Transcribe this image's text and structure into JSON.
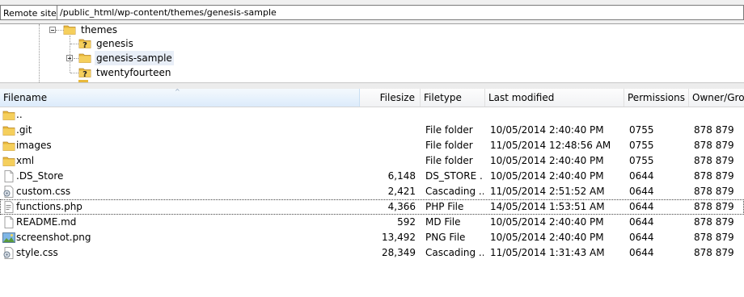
{
  "remote": {
    "label": "Remote site:",
    "path": "/public_html/wp-content/themes/genesis-sample"
  },
  "tree": {
    "items": [
      {
        "label": "themes",
        "icon": "folder-icon"
      },
      {
        "label": "genesis",
        "icon": "unknown-folder-icon"
      },
      {
        "label": "genesis-sample",
        "icon": "folder-icon"
      },
      {
        "label": "twentyfourteen",
        "icon": "unknown-folder-icon"
      }
    ]
  },
  "columns": {
    "filename": "Filename",
    "filesize": "Filesize",
    "filetype": "Filetype",
    "modified": "Last modified",
    "permissions": "Permissions",
    "owner": "Owner/Gro..."
  },
  "sort": {
    "column": "Filename",
    "indicator": "^"
  },
  "files": [
    {
      "name": "..",
      "size": "",
      "type": "",
      "modified": "",
      "perm": "",
      "owner": "",
      "icon": "folder-icon"
    },
    {
      "name": ".git",
      "size": "",
      "type": "File folder",
      "modified": "10/05/2014 2:40:40 PM",
      "perm": "0755",
      "owner": "878 879",
      "icon": "folder-icon"
    },
    {
      "name": "images",
      "size": "",
      "type": "File folder",
      "modified": "11/05/2014 12:48:56 AM",
      "perm": "0755",
      "owner": "878 879",
      "icon": "folder-icon"
    },
    {
      "name": "xml",
      "size": "",
      "type": "File folder",
      "modified": "10/05/2014 2:40:40 PM",
      "perm": "0755",
      "owner": "878 879",
      "icon": "folder-icon"
    },
    {
      "name": ".DS_Store",
      "size": "6,148",
      "type": "DS_STORE ...",
      "modified": "10/05/2014 2:40:40 PM",
      "perm": "0644",
      "owner": "878 879",
      "icon": "blank-file-icon"
    },
    {
      "name": "custom.css",
      "size": "2,421",
      "type": "Cascading ...",
      "modified": "11/05/2014 2:51:52 AM",
      "perm": "0644",
      "owner": "878 879",
      "icon": "css-file-icon"
    },
    {
      "name": "functions.php",
      "size": "4,366",
      "type": "PHP File",
      "modified": "14/05/2014 1:53:51 AM",
      "perm": "0644",
      "owner": "878 879",
      "icon": "php-file-icon"
    },
    {
      "name": "README.md",
      "size": "592",
      "type": "MD File",
      "modified": "10/05/2014 2:40:40 PM",
      "perm": "0644",
      "owner": "878 879",
      "icon": "blank-file-icon"
    },
    {
      "name": "screenshot.png",
      "size": "13,492",
      "type": "PNG File",
      "modified": "10/05/2014 2:40:40 PM",
      "perm": "0644",
      "owner": "878 879",
      "icon": "image-file-icon"
    },
    {
      "name": "style.css",
      "size": "28,349",
      "type": "Cascading ...",
      "modified": "11/05/2014 1:31:43 AM",
      "perm": "0644",
      "owner": "878 879",
      "icon": "css-file-icon"
    }
  ],
  "focused_row": "functions.php"
}
